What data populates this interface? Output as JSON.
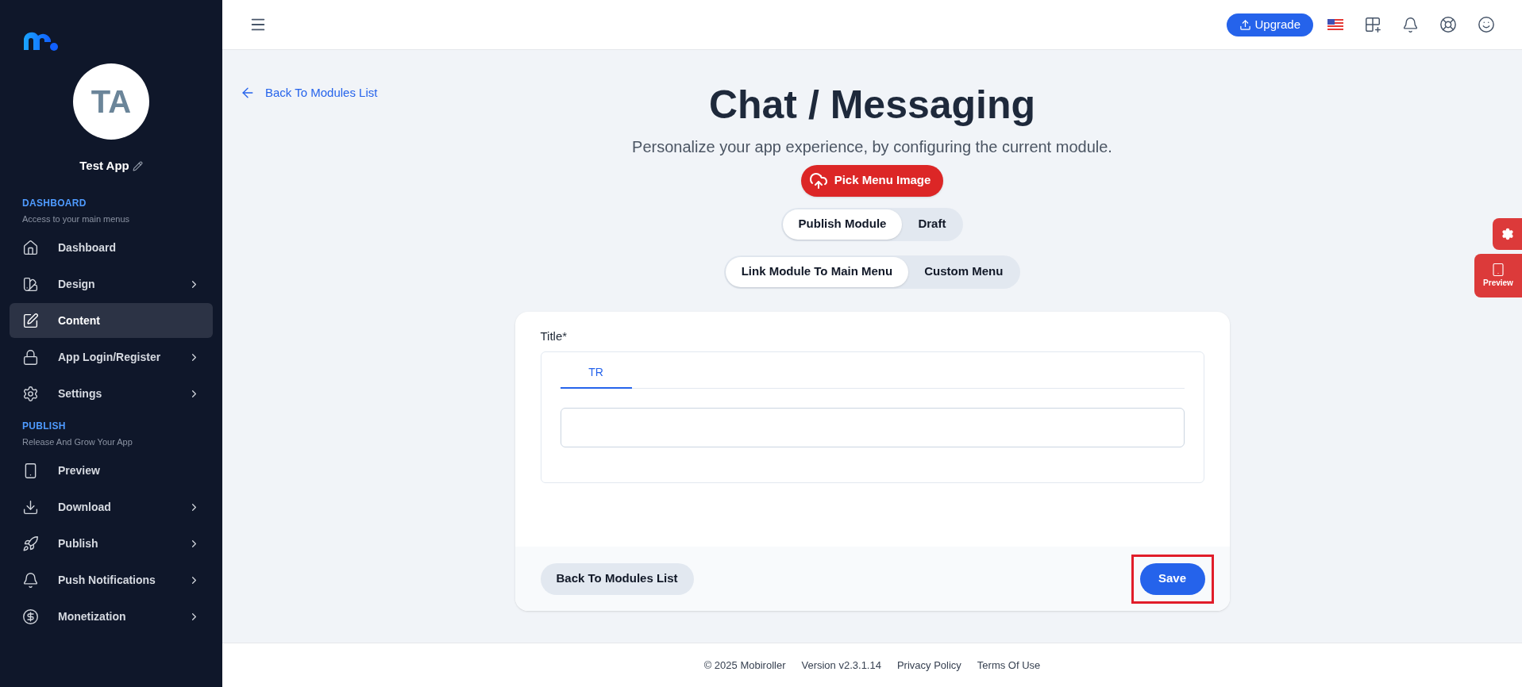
{
  "sidebar": {
    "app_initials": "TA",
    "app_name": "Test App",
    "sections": [
      {
        "title": "DASHBOARD",
        "subtitle": "Access to your main menus",
        "items": [
          {
            "label": "Dashboard",
            "kind": "link",
            "selected": false
          },
          {
            "label": "Design",
            "kind": "submenu",
            "selected": false
          },
          {
            "label": "Content",
            "kind": "link",
            "selected": true
          },
          {
            "label": "App Login/Register",
            "kind": "submenu",
            "selected": false
          },
          {
            "label": "Settings",
            "kind": "submenu",
            "selected": false
          }
        ]
      },
      {
        "title": "PUBLISH",
        "subtitle": "Release And Grow Your App",
        "items": [
          {
            "label": "Preview",
            "kind": "link",
            "selected": false
          },
          {
            "label": "Download",
            "kind": "submenu",
            "selected": false
          },
          {
            "label": "Publish",
            "kind": "submenu",
            "selected": false
          },
          {
            "label": "Push Notifications",
            "kind": "submenu",
            "selected": false
          },
          {
            "label": "Monetization",
            "kind": "submenu",
            "selected": false
          }
        ]
      }
    ]
  },
  "topbar": {
    "upgrade": "Upgrade"
  },
  "back_link": "Back To Modules List",
  "title": "Chat / Messaging",
  "subtitle": "Personalize your app experience, by configuring the current module.",
  "pick_image": "Pick Menu Image",
  "publish_toggle": [
    {
      "label": "Publish Module",
      "selected": true
    },
    {
      "label": "Draft",
      "selected": false
    }
  ],
  "menu_toggle": [
    {
      "label": "Link Module To Main Menu",
      "selected": true
    },
    {
      "label": "Custom Menu",
      "selected": false
    }
  ],
  "form": {
    "field_label": "Title*",
    "language_tabs": [
      {
        "label": "TR",
        "selected": true
      }
    ],
    "back_button": "Back To Modules List",
    "save_button": "Save",
    "save_highlighted": true
  },
  "side_buttons": {
    "preview": "Preview"
  },
  "footer": [
    "© 2025 Mobiroller",
    "Version v2.3.1.14",
    "Privacy Policy",
    "Terms Of Use"
  ]
}
